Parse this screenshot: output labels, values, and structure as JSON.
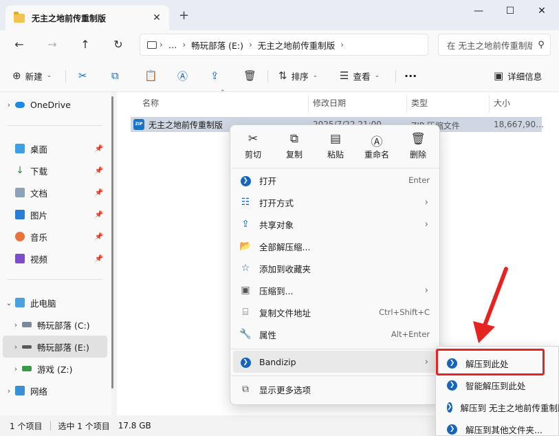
{
  "window": {
    "tab_title": "无主之地前传重制版",
    "tab_close": "✕",
    "new_tab": "+",
    "minimize": "—",
    "maximize": "☐",
    "close": "✕"
  },
  "nav": {
    "back": "←",
    "forward": "→",
    "up": "↑",
    "refresh": "↻"
  },
  "address": {
    "breadcrumb": [
      "…",
      "畅玩部落 (E:)",
      "无主之地前传重制版"
    ],
    "search_placeholder": "在 无主之地前传重制版 中搜索"
  },
  "toolbar": {
    "new_label": "新建",
    "sort_label": "排序",
    "view_label": "查看",
    "more_label": "···",
    "details_label": "详细信息"
  },
  "sidebar": {
    "onedrive": "OneDrive",
    "quick": [
      {
        "label": "桌面"
      },
      {
        "label": "下载"
      },
      {
        "label": "文档"
      },
      {
        "label": "图片"
      },
      {
        "label": "音乐"
      },
      {
        "label": "视频"
      }
    ],
    "this_pc": "此电脑",
    "drives": [
      {
        "label": "畅玩部落 (C:)"
      },
      {
        "label": "畅玩部落 (E:)"
      },
      {
        "label": "游戏 (Z:)"
      }
    ],
    "network": "网络"
  },
  "columns": {
    "name": "名称",
    "modified": "修改日期",
    "type": "类型",
    "size": "大小"
  },
  "file": {
    "name": "无主之地前传重制版",
    "modified": "2025/7/22 21:00",
    "type": "ZIP 压缩文件",
    "size": "18,667,90…",
    "icon_text": "ZIP"
  },
  "status": {
    "count": "1 个项目",
    "selected": "选中 1 个项目",
    "size": "17.8 GB"
  },
  "context_menu": {
    "tools": [
      {
        "label": "剪切",
        "icon": "scissors-icon"
      },
      {
        "label": "复制",
        "icon": "copy-icon"
      },
      {
        "label": "粘贴",
        "icon": "paste-icon"
      },
      {
        "label": "重命名",
        "icon": "rename-icon"
      },
      {
        "label": "删除",
        "icon": "trash-icon"
      }
    ],
    "items": [
      {
        "label": "打开",
        "shortcut": "Enter"
      },
      {
        "label": "打开方式",
        "shortcut": ""
      },
      {
        "label": "共享对象",
        "shortcut": ""
      },
      {
        "label": "全部解压缩...",
        "shortcut": ""
      },
      {
        "label": "添加到收藏夹",
        "shortcut": ""
      },
      {
        "label": "压缩到...",
        "shortcut": ""
      },
      {
        "label": "复制文件地址",
        "shortcut": "Ctrl+Shift+C"
      },
      {
        "label": "属性",
        "shortcut": "Alt+Enter"
      },
      {
        "label": "Bandizip",
        "shortcut": ""
      },
      {
        "label": "显示更多选项",
        "shortcut": ""
      }
    ]
  },
  "submenu": {
    "items": [
      {
        "label": "解压到此处"
      },
      {
        "label": "智能解压到此处"
      },
      {
        "label": "解压到 无主之地前传重制版\\"
      },
      {
        "label": "解压到其他文件夹..."
      }
    ]
  },
  "colors": {
    "accent": "#1565c0",
    "highlight_box": "#e52421",
    "selected_row": "#cfd7e2"
  }
}
